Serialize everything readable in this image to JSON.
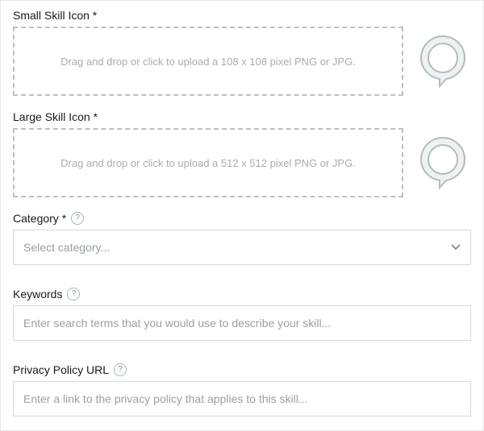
{
  "smallIcon": {
    "label": "Small Skill Icon *",
    "dropText": "Drag and drop or click to upload a 108 x 108 pixel PNG or JPG."
  },
  "largeIcon": {
    "label": "Large Skill Icon *",
    "dropText": "Drag and drop or click to upload a 512 x 512 pixel PNG or JPG."
  },
  "category": {
    "label": "Category *",
    "placeholder": "Select category..."
  },
  "keywords": {
    "label": "Keywords",
    "placeholder": "Enter search terms that you would use to describe your skill..."
  },
  "privacy": {
    "label": "Privacy Policy URL",
    "placeholder": "Enter a link to the privacy policy that applies to this skill..."
  },
  "helpGlyph": "?"
}
